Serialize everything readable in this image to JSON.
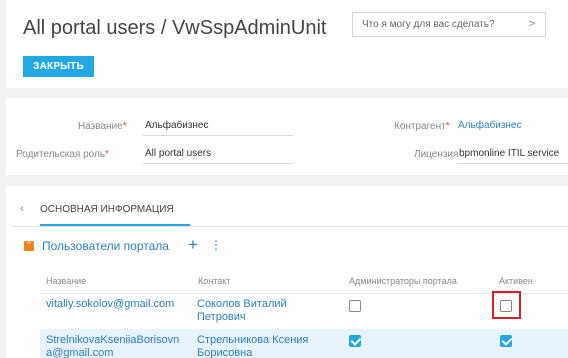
{
  "header": {
    "title": "All portal users / VwSspAdminUnit",
    "ask_placeholder": "Что я могу для вас сделать?",
    "ask_arrow": ">",
    "close_label": "ЗАКРЫТЬ"
  },
  "fields": {
    "name_label": "Название",
    "name_value": "Альфабизнес",
    "parent_role_label": "Родительская роль",
    "parent_role_value": "All portal users",
    "account_label": "Контрагент",
    "account_value": "Альфабизнес",
    "license_label": "Лицензия",
    "license_value": "bpmonline ITIL service",
    "required_mark": "*"
  },
  "tabs": {
    "back_icon": "‹",
    "active_tab": "ОСНОВНАЯ ИНФОРМАЦИЯ"
  },
  "section": {
    "toggle_icon": "^",
    "title": "Пользователи портала",
    "add_icon": "+",
    "menu_icon": "⋮"
  },
  "table": {
    "columns": [
      "Название",
      "Контакт",
      "Администраторы портала",
      "Активен"
    ],
    "rows": [
      {
        "name_line1": "vitaliy.sokolov@gmail.com",
        "name_line2": "",
        "contact_line1": "Соколов Виталий",
        "contact_line2": "Петрович",
        "admin": false,
        "active": false
      },
      {
        "name_line1": "StrelnikovaKseniiaBorisovn",
        "name_line2": "a@gmail.com",
        "contact_line1": "Стрельникова Ксения",
        "contact_line2": "Борисовна",
        "admin": true,
        "active": true
      }
    ]
  },
  "colors": {
    "accent": "#23a9e1",
    "link": "#2b7fc2",
    "section_toggle": "#f58220",
    "highlight": "#d6212a"
  }
}
